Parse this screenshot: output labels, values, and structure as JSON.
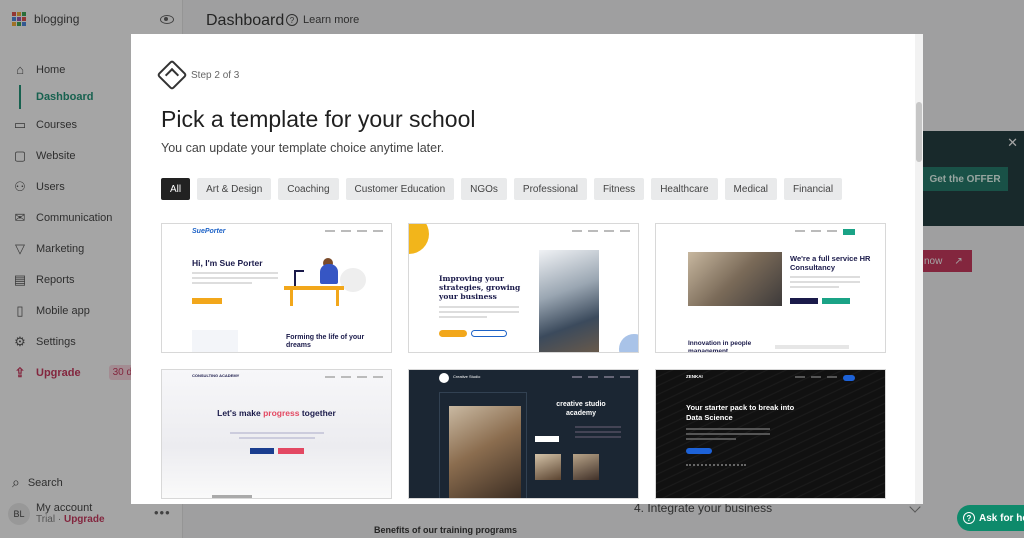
{
  "app": {
    "workspace": "blogging"
  },
  "sidebar": {
    "items": [
      {
        "label": "Home",
        "icon": "home-icon"
      },
      {
        "label": "Courses",
        "icon": "courses-icon"
      },
      {
        "label": "Website",
        "icon": "monitor-icon"
      },
      {
        "label": "Users",
        "icon": "users-icon"
      },
      {
        "label": "Communication",
        "icon": "mail-icon"
      },
      {
        "label": "Marketing",
        "icon": "funnel-icon"
      },
      {
        "label": "Reports",
        "icon": "chart-icon"
      },
      {
        "label": "Mobile app",
        "icon": "phone-icon"
      },
      {
        "label": "Settings",
        "icon": "gear-icon"
      },
      {
        "label": "Upgrade",
        "icon": "upgrade-icon"
      }
    ],
    "sub_item": "Dashboard",
    "upgrade_badge": "30 d",
    "search_label": "Search",
    "account": {
      "initials": "BL",
      "name": "My account",
      "trial": "Trial ·",
      "upgrade": "Upgrade"
    }
  },
  "header": {
    "title": "Dashboard",
    "learn_more": "Learn more"
  },
  "background": {
    "offer_button": "Get the OFFER",
    "now_button": "now",
    "integrate": "4. Integrate your business",
    "benefits": "Benefits of our training programs",
    "ask_button": "Ask for he"
  },
  "modal": {
    "step": "Step 2 of 3",
    "title": "Pick a template for your school",
    "subtitle": "You can update your template choice anytime later.",
    "filters": [
      "All",
      "Art & Design",
      "Coaching",
      "Customer Education",
      "NGOs",
      "Professional",
      "Fitness",
      "Healthcare",
      "Medical",
      "Financial"
    ],
    "active_filter": "All",
    "templates": [
      {
        "logo": "SuePorter",
        "heading": "Hi, I'm Sue Porter",
        "subheading": "Forming the life of your dreams"
      },
      {
        "heading": "Improving your strategies, growing your business"
      },
      {
        "heading": "We're a full service HR Consultancy",
        "subheading": "Innovation in people management"
      },
      {
        "logo": "CONSULTING ACADEMY",
        "heading_before": "Let's make ",
        "heading_accent": "progress",
        "heading_after": " together"
      },
      {
        "logo": "Creative Studio",
        "heading": "creative studio academy"
      },
      {
        "logo": "ZENKAI",
        "heading": "Your starter pack to break into Data Science"
      }
    ]
  },
  "colors": {
    "accent_green": "#0b8a6b",
    "upgrade_red": "#c4254f",
    "chip_active": "#222222"
  }
}
